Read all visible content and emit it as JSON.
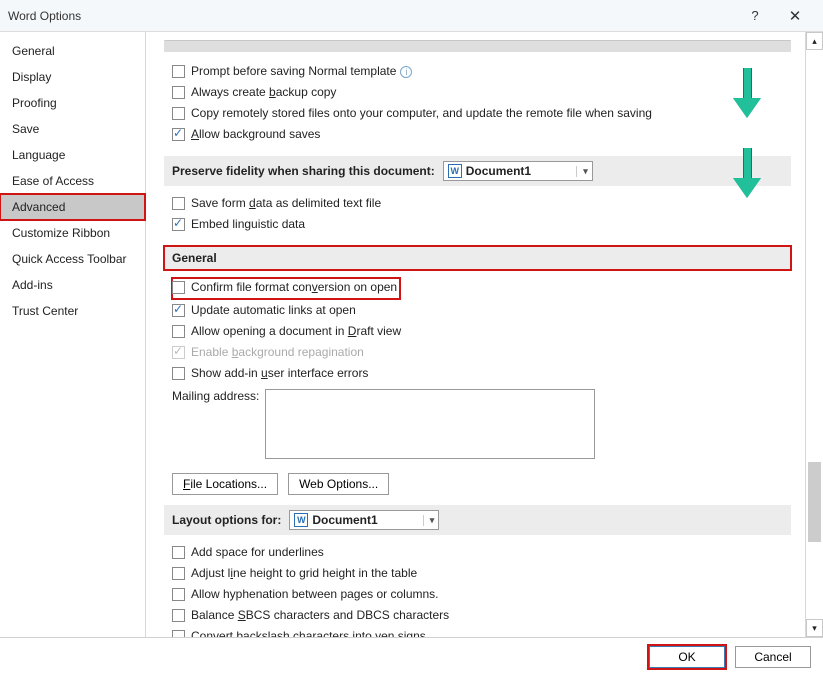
{
  "title": "Word Options",
  "sidebar": {
    "items": [
      {
        "label": "General"
      },
      {
        "label": "Display"
      },
      {
        "label": "Proofing"
      },
      {
        "label": "Save"
      },
      {
        "label": "Language"
      },
      {
        "label": "Ease of Access"
      },
      {
        "label": "Advanced",
        "selected": true
      },
      {
        "label": "Customize Ribbon"
      },
      {
        "label": "Quick Access Toolbar"
      },
      {
        "label": "Add-ins"
      },
      {
        "label": "Trust Center"
      }
    ]
  },
  "save_group": {
    "opt1": "Prompt before saving Normal template",
    "opt2_pre": "Always create ",
    "opt2_u": "b",
    "opt2_post": "ackup copy",
    "opt3": "Copy remotely stored files onto your computer, and update the remote file when saving",
    "opt4_u": "A",
    "opt4_post": "llow background saves"
  },
  "preserve": {
    "label": "Preserve fidelity when sharing this document:",
    "doc": "Document1",
    "opt1_pre": "Save form ",
    "opt1_u": "d",
    "opt1_post": "ata as delimited text file",
    "opt2": "Embed linguistic data"
  },
  "general": {
    "title": "General",
    "opt1_pre": "Confirm file format con",
    "opt1_u": "v",
    "opt1_post": "ersion on open",
    "opt2": "Update automatic links at open",
    "opt3_pre": "Allow opening a document in ",
    "opt3_u": "D",
    "opt3_post": "raft view",
    "opt4_pre": "Enable ",
    "opt4_u": "b",
    "opt4_post": "ackground repagination",
    "opt5_pre": "Show add-in ",
    "opt5_u": "u",
    "opt5_post": "ser interface errors",
    "mailing": "Mailing address:",
    "file_locations": "File Locations...",
    "web_options": "Web Options..."
  },
  "layout": {
    "label": "Layout options for:",
    "doc": "Document1",
    "opt1": "Add space for underlines",
    "opt2_pre": "Adjust l",
    "opt2_u": "i",
    "opt2_post": "ne height to grid height in the table",
    "opt3_pre": "Allow hyphenation between pa",
    "opt3_u": "g",
    "opt3_post": "es or columns.",
    "opt4_pre": "Balance ",
    "opt4_u": "S",
    "opt4_post": "BCS characters and DBCS characters",
    "opt5": "Convert backslash characters into yen signs"
  },
  "footer": {
    "ok": "OK",
    "cancel": "Cancel"
  }
}
